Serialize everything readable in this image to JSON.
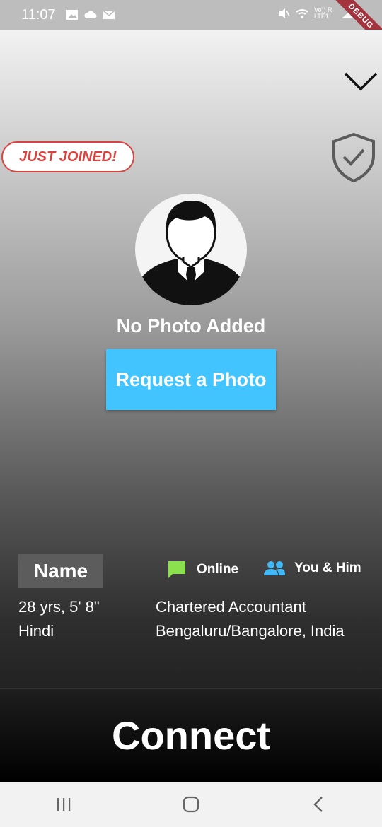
{
  "status_bar": {
    "time": "11:07",
    "left_icons": [
      "image-icon",
      "cloud-icon",
      "mail-icon"
    ],
    "right_icons": [
      "mute-icon",
      "wifi-icon",
      "volte-icon",
      "signal-icon"
    ],
    "volte_text": "Vo)) R LTE1",
    "debug_banner": "DEBUG"
  },
  "profile": {
    "badge": "JUST JOINED!",
    "no_photo_label": "No Photo Added",
    "request_photo_label": "Request a Photo",
    "name": "Name",
    "online_label": "Online",
    "relation_label": "You & Him",
    "age_height": "28 yrs, 5' 8\"",
    "language": "Hindi",
    "profession": "Chartered Accountant",
    "location": "Bengaluru/Bangalore, India"
  },
  "actions": {
    "connect_label": "Connect"
  },
  "colors": {
    "accent": "#41c4ff",
    "badge_red": "#d9433f",
    "online_green": "#8be04e",
    "people_blue": "#41b8f5",
    "debug_red": "#a3333d"
  }
}
